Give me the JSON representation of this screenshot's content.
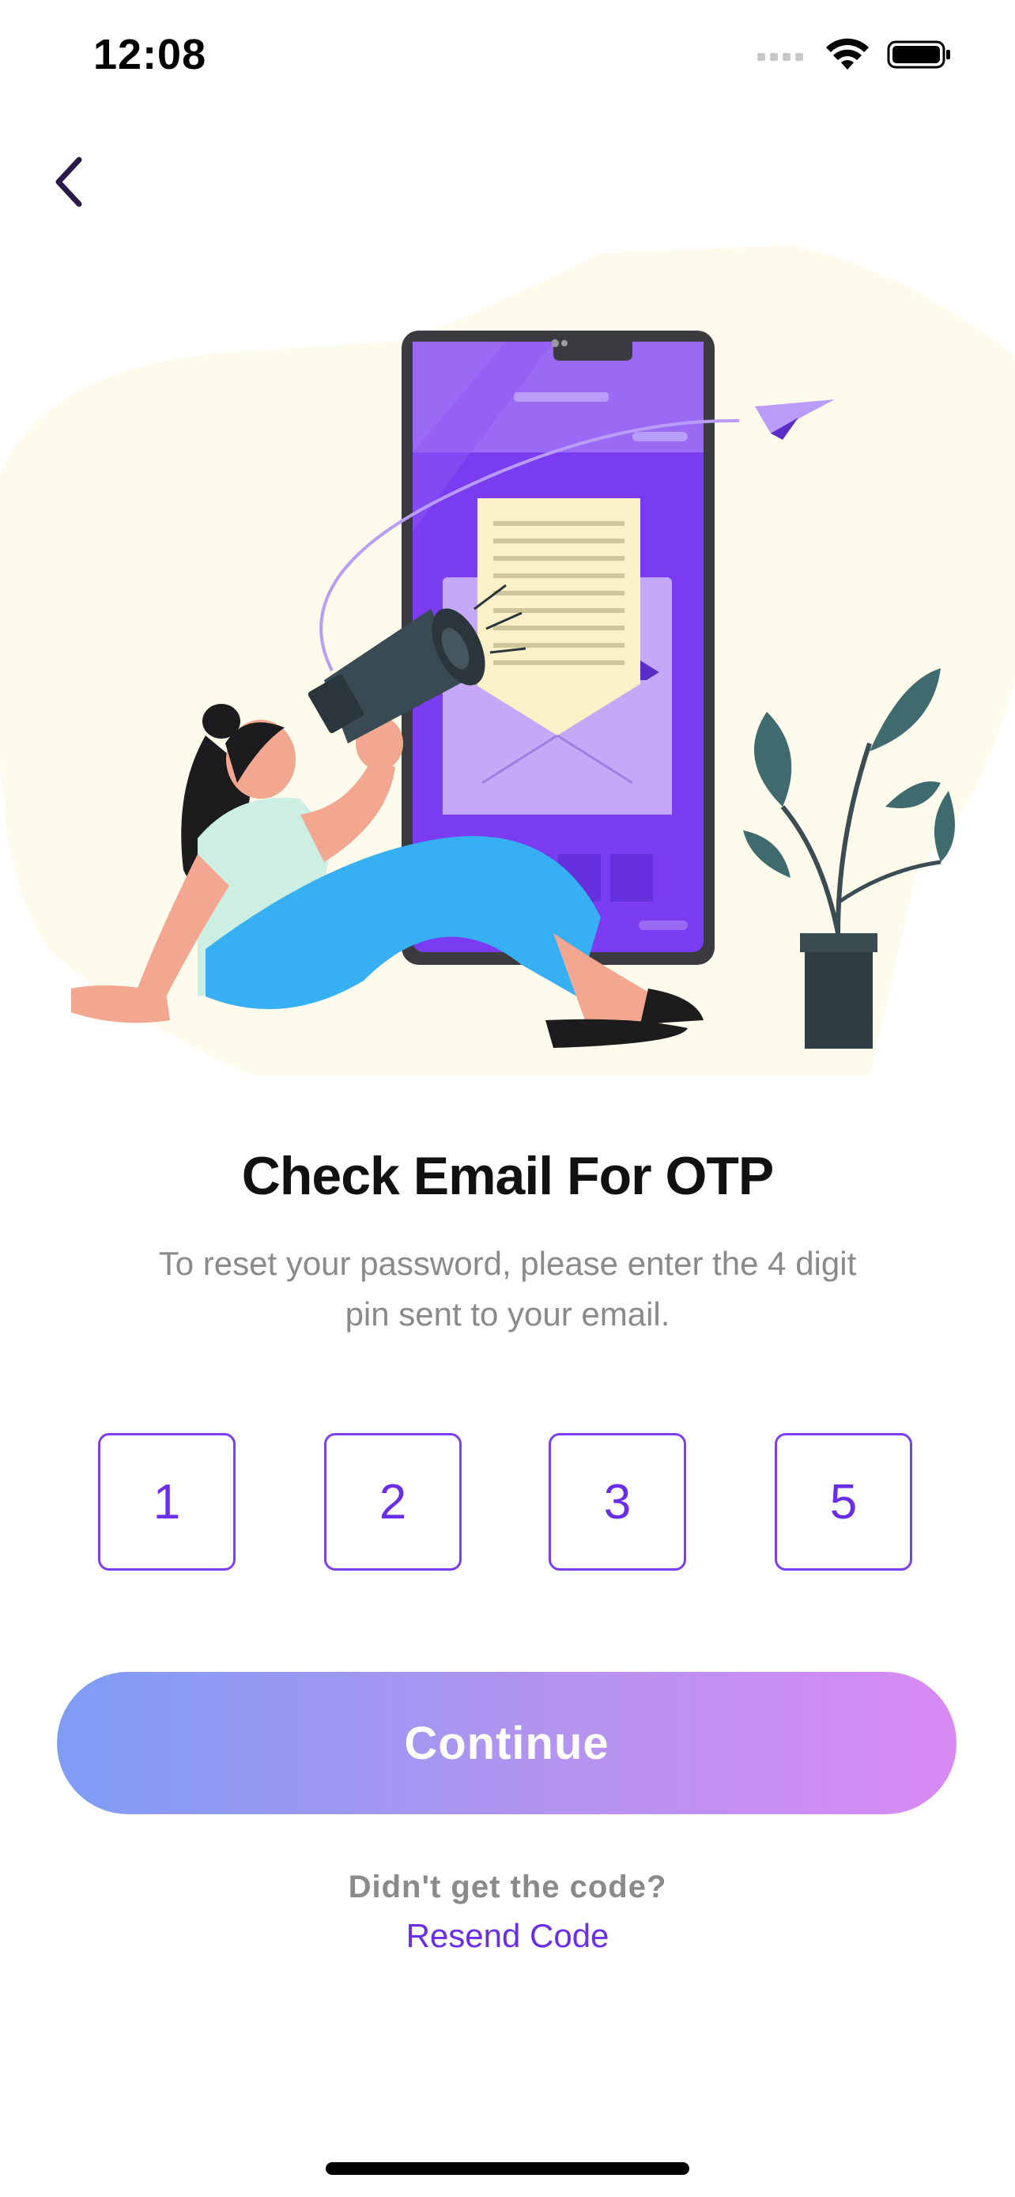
{
  "status_bar": {
    "time": "12:08"
  },
  "header": {
    "back_icon": "chevron-left-icon"
  },
  "content": {
    "title": "Check Email For OTP",
    "subtitle": "To reset your password, please enter the 4 digit pin sent to your email."
  },
  "otp": {
    "digits": [
      "1",
      "2",
      "3",
      "5"
    ]
  },
  "actions": {
    "continue_label": "Continue",
    "resend_prompt": "Didn't get the code?",
    "resend_label": "Resend Code"
  },
  "colors": {
    "accent": "#6a2ee8",
    "gradient_start": "#7f9cf5",
    "gradient_end": "#d98af3",
    "text_muted": "#8a8a8a"
  }
}
